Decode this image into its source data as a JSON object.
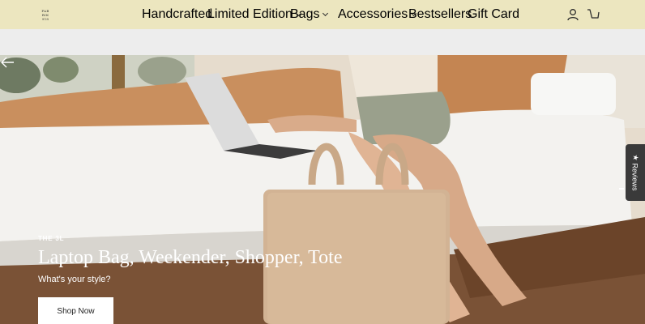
{
  "header": {
    "logo_lines": [
      "FAB",
      "RIK",
      "918"
    ],
    "nav": [
      {
        "label": "Handcrafted",
        "has_dropdown": false
      },
      {
        "label": "Limited Edition",
        "has_dropdown": true
      },
      {
        "label": "Bags",
        "has_dropdown": true
      },
      {
        "label": "Accessories",
        "has_dropdown": true
      },
      {
        "label": "Bestsellers",
        "has_dropdown": false
      },
      {
        "label": "Gift Card",
        "has_dropdown": false
      }
    ],
    "icons": [
      "account-icon",
      "cart-icon"
    ]
  },
  "hero": {
    "eyebrow": "THE 3L",
    "headline": "Laptop Bag, Weekender, Shopper, Tote",
    "subheadline": "What's your style?",
    "cta_label": "Shop Now"
  },
  "reviews_tab": {
    "label": "Reviews",
    "icon": "star-icon"
  },
  "colors": {
    "header_bg": "#ece6bf",
    "band_bg": "#ededed",
    "reviews_bg": "#3a3a3a"
  }
}
